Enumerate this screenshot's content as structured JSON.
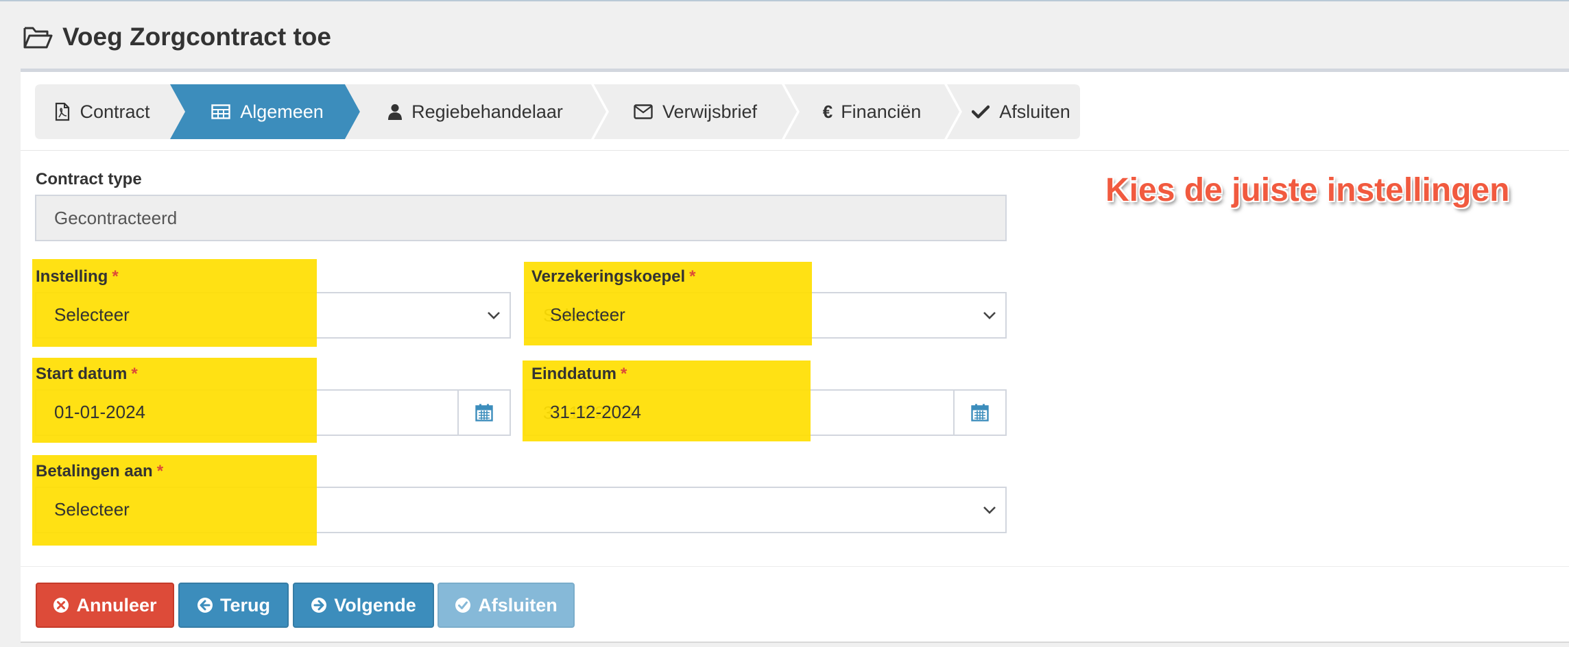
{
  "page": {
    "title": "Voeg Zorgcontract toe"
  },
  "wizard": {
    "steps": [
      {
        "label": "Contract",
        "icon": "file-pdf-icon",
        "active": false
      },
      {
        "label": "Algemeen",
        "icon": "table-icon",
        "active": true
      },
      {
        "label": "Regiebehandelaar",
        "icon": "user-icon",
        "active": false
      },
      {
        "label": "Verwijsbrief",
        "icon": "envelope-icon",
        "active": false
      },
      {
        "label": "Financiën",
        "icon": "euro-icon",
        "active": false
      },
      {
        "label": "Afsluiten",
        "icon": "check-icon",
        "active": false
      }
    ]
  },
  "form": {
    "contract_type": {
      "label": "Contract type",
      "value": "Gecontracteerd"
    },
    "instelling": {
      "label": "Instelling",
      "required": "*",
      "value": "Selecteer"
    },
    "verzekeringskoepel": {
      "label": "Verzekeringskoepel",
      "required": "*",
      "value": "Selecteer"
    },
    "start_datum": {
      "label": "Start datum",
      "required": "*",
      "value": "01-01-2024",
      "icon": "calendar-icon"
    },
    "einddatum": {
      "label": "Einddatum",
      "required": "*",
      "value": "31-12-2024",
      "icon": "calendar-icon"
    },
    "betalingen_aan": {
      "label": "Betalingen aan",
      "required": "*",
      "value": "Selecteer"
    }
  },
  "annotation": {
    "text": "Kies de juiste instellingen",
    "color": "#f15a3f"
  },
  "buttons": {
    "annuleer": {
      "label": "Annuleer",
      "icon": "times-circle-icon",
      "color": "#dd4b39"
    },
    "terug": {
      "label": "Terug",
      "icon": "arrow-circle-left-icon",
      "color": "#3c8dbc"
    },
    "volgende": {
      "label": "Volgende",
      "icon": "arrow-circle-right-icon",
      "color": "#3c8dbc"
    },
    "afsluiten": {
      "label": "Afsluiten",
      "icon": "check-circle-icon",
      "color": "#86b9d8",
      "disabled": true
    }
  },
  "colors": {
    "accent": "#3c8dbc",
    "highlight": "#ffde00",
    "required": "#dd4b39"
  }
}
